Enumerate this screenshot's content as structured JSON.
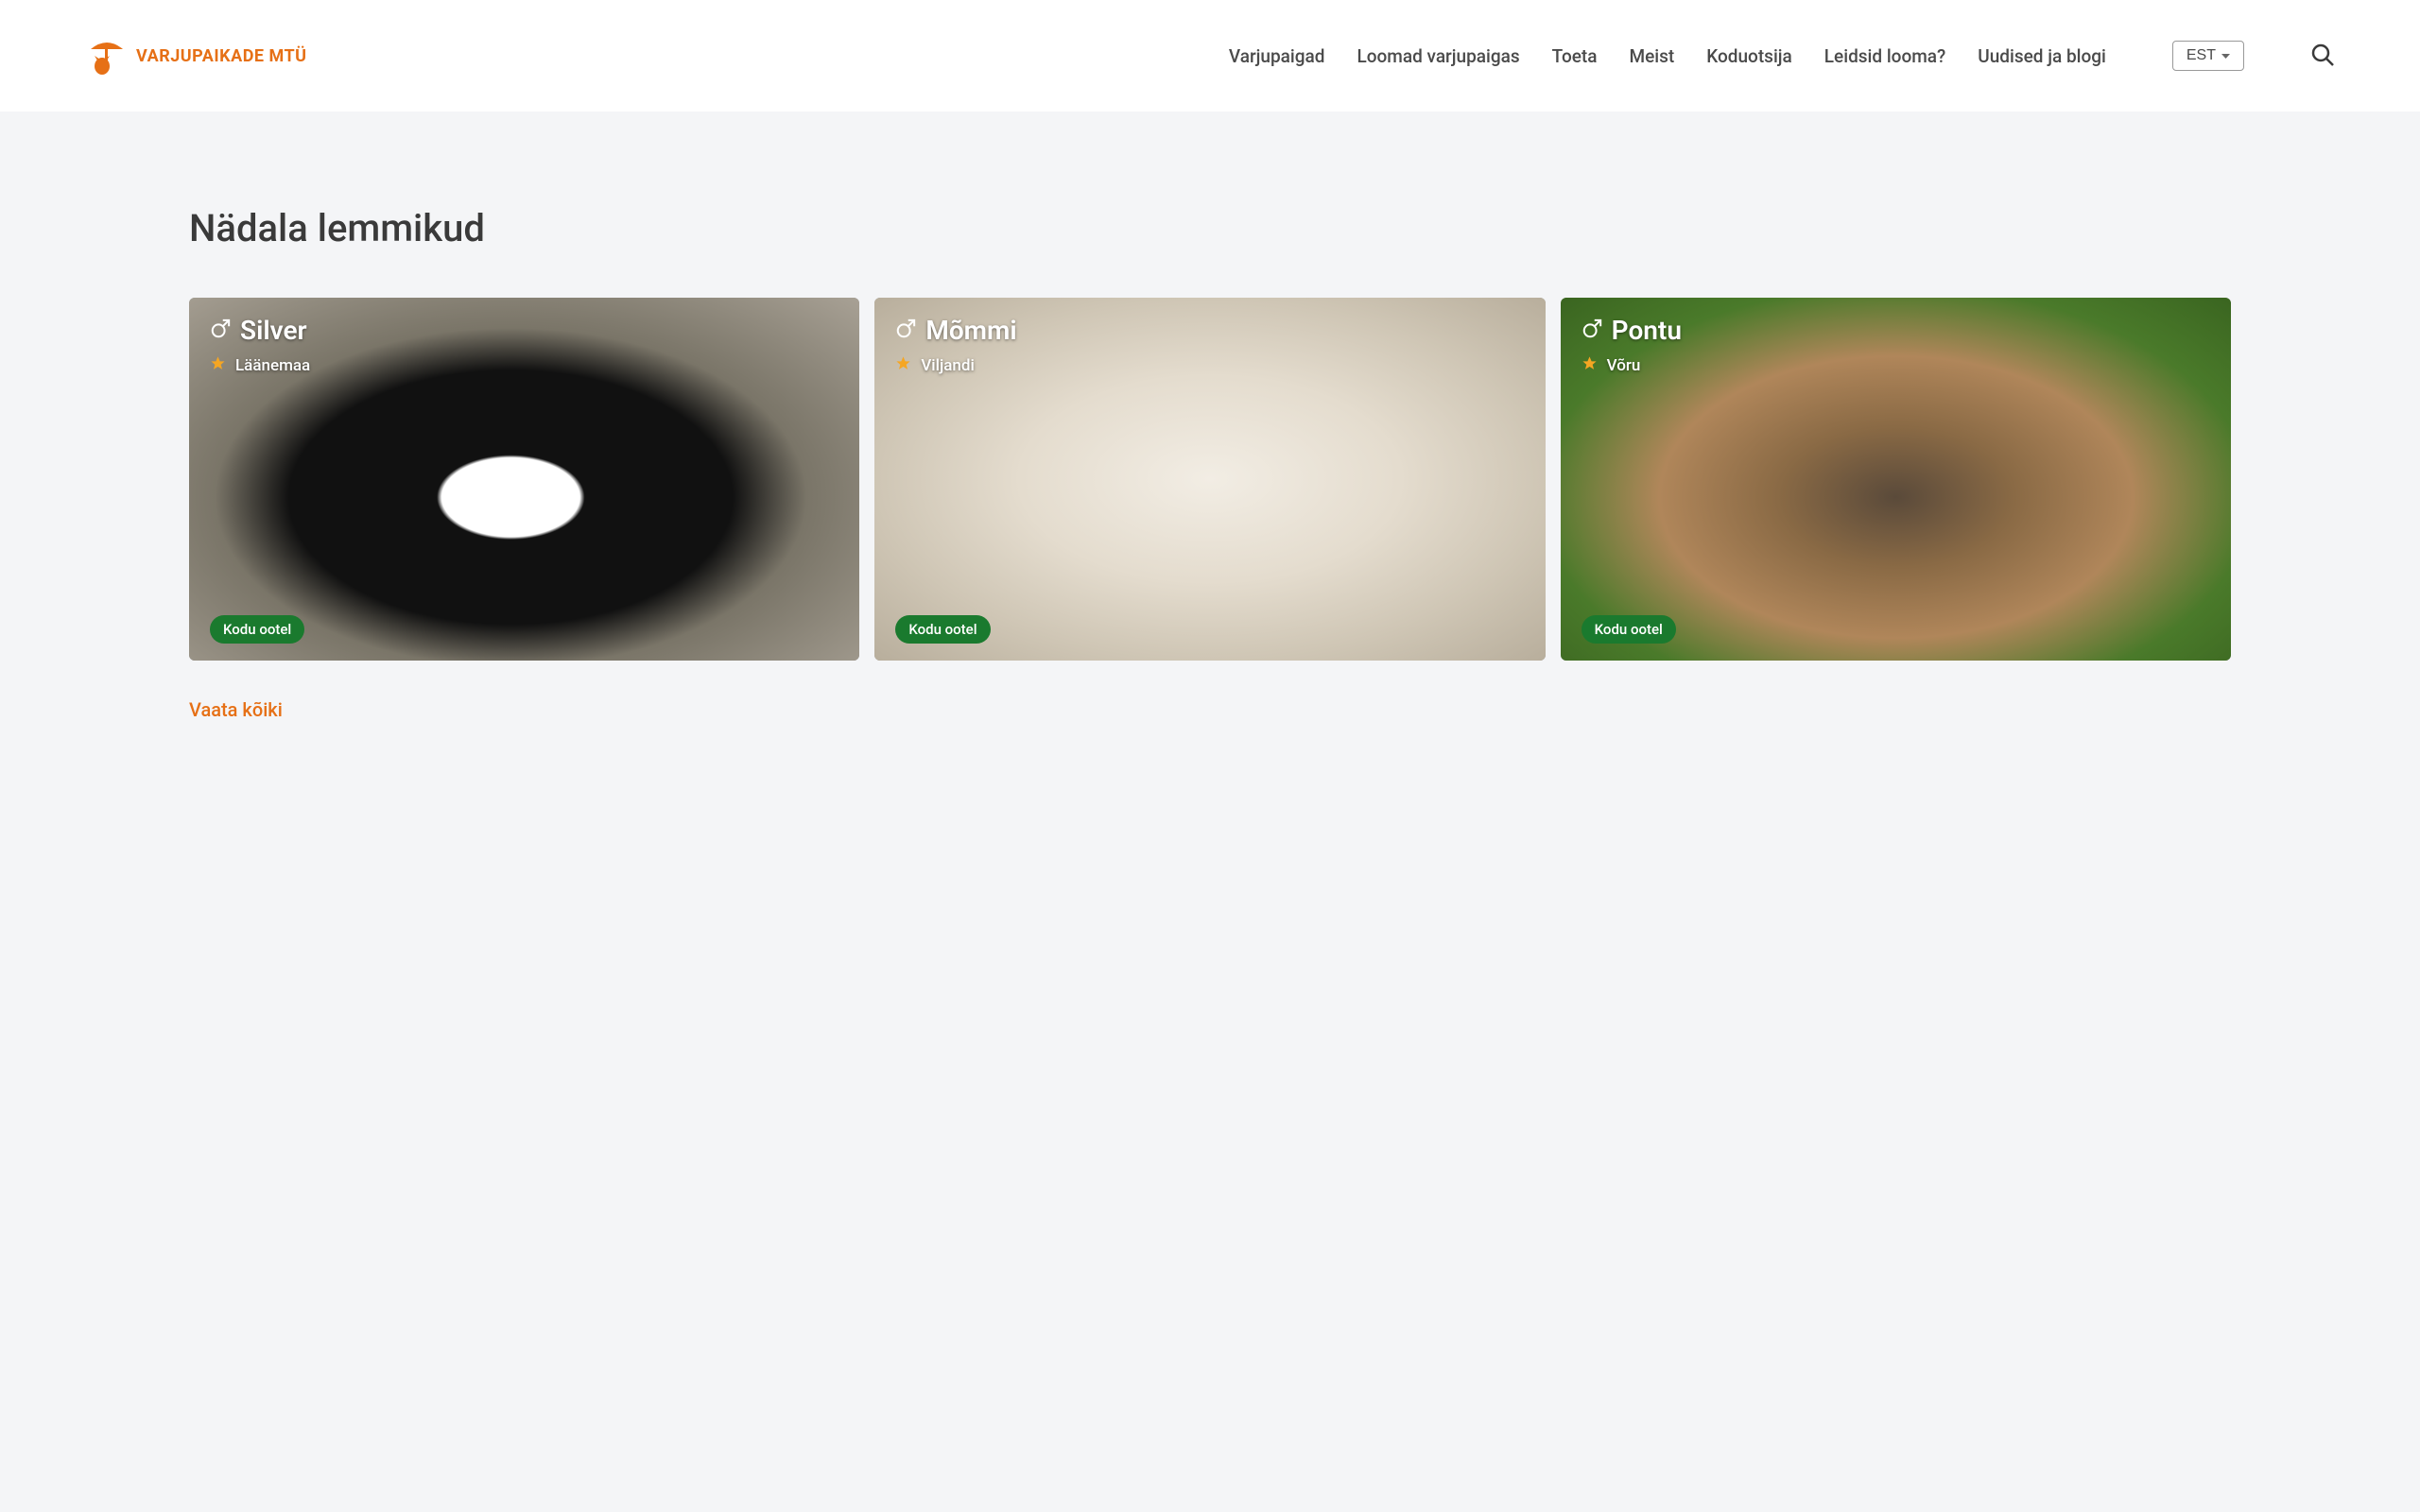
{
  "brand": {
    "name": "VARJUPAIKADE MTÜ"
  },
  "nav": {
    "items": [
      {
        "label": "Varjupaigad"
      },
      {
        "label": "Loomad varjupaigas"
      },
      {
        "label": "Toeta"
      },
      {
        "label": "Meist"
      },
      {
        "label": "Koduotsija"
      },
      {
        "label": "Leidsid looma?"
      },
      {
        "label": "Uudised ja blogi"
      }
    ]
  },
  "lang": {
    "selected": "EST"
  },
  "section": {
    "title": "Nädala lemmikud",
    "view_all": "Vaata kõiki"
  },
  "animals": [
    {
      "name": "Silver",
      "sex": "male",
      "location": "Läänemaa",
      "status": "Kodu ootel",
      "img_class": "img-cat"
    },
    {
      "name": "Mõmmi",
      "sex": "male",
      "location": "Viljandi",
      "status": "Kodu ootel",
      "img_class": "img-dog-white"
    },
    {
      "name": "Pontu",
      "sex": "male",
      "location": "Võru",
      "status": "Kodu ootel",
      "img_class": "img-dog-brown"
    }
  ],
  "colors": {
    "accent": "#e67016",
    "status_green": "#1a7a2e",
    "star": "#f5a623"
  }
}
